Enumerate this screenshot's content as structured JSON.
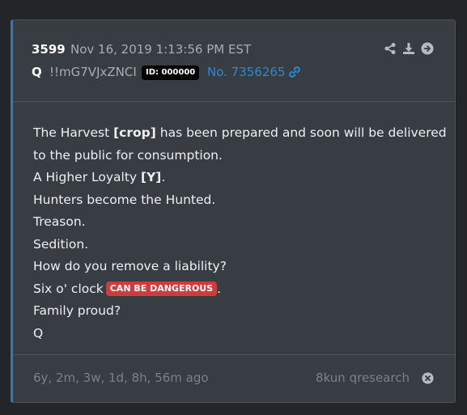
{
  "post": {
    "number": "3599",
    "date": "Nov 16, 2019 1:13:56 PM EST",
    "author": "Q",
    "tripcode": "!!mG7VJxZNCI",
    "id_badge": "ID: 000000",
    "post_link": "No. 7356265",
    "actions": [
      "share-icon",
      "download-icon",
      "arrow-right-circle-icon"
    ],
    "body": {
      "line1_pre": "The Harvest ",
      "line1_bold": "[crop]",
      "line1_post": " has been prepared and soon will be delivered",
      "line2": "to the public for consumption.",
      "line3_pre": "A Higher Loyalty ",
      "line3_bold": "[Y]",
      "line3_post": ".",
      "line4": "Hunters become the Hunted.",
      "line5": "Treason.",
      "line6": "Sedition.",
      "line7": "How do you remove a liability?",
      "line8_pre": "Six o' clock",
      "line8_badge": "CAN BE DANGEROUS",
      "line8_post": ".",
      "line9": "Family proud?",
      "line10": "Q"
    },
    "footer": {
      "ago": "6y, 2m, 3w, 1d, 8h, 56m ago",
      "source": "8kun qresearch"
    }
  },
  "colors": {
    "page_bg": "#232529",
    "card_bg": "#383c43",
    "accent": "#2f7bbf",
    "link": "#2a8ad0",
    "danger": "#d33a3a"
  }
}
